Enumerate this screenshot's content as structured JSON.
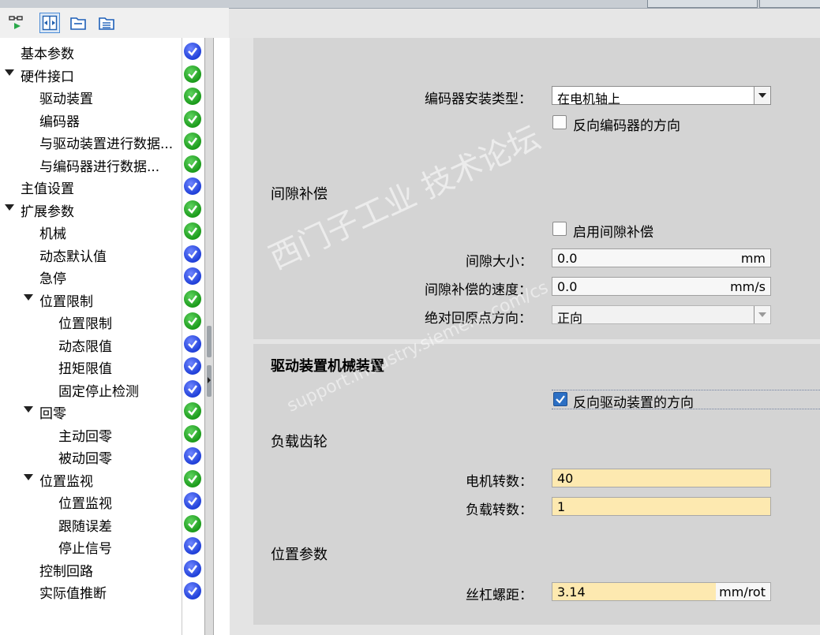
{
  "tree": [
    {
      "label": "基本参数",
      "depth": 0,
      "expander": false,
      "status": "blue"
    },
    {
      "label": "硬件接口",
      "depth": 0,
      "expander": true,
      "status": "green"
    },
    {
      "label": "驱动装置",
      "depth": 1,
      "expander": false,
      "status": "green"
    },
    {
      "label": "编码器",
      "depth": 1,
      "expander": false,
      "status": "green"
    },
    {
      "label": "与驱动装置进行数据...",
      "depth": 1,
      "expander": false,
      "status": "green"
    },
    {
      "label": "与编码器进行数据...",
      "depth": 1,
      "expander": false,
      "status": "green"
    },
    {
      "label": "主值设置",
      "depth": 0,
      "expander": false,
      "status": "blue"
    },
    {
      "label": "扩展参数",
      "depth": 0,
      "expander": true,
      "status": "green"
    },
    {
      "label": "机械",
      "depth": 1,
      "expander": false,
      "status": "green",
      "selected": true
    },
    {
      "label": "动态默认值",
      "depth": 1,
      "expander": false,
      "status": "blue"
    },
    {
      "label": "急停",
      "depth": 1,
      "expander": false,
      "status": "blue"
    },
    {
      "label": "位置限制",
      "depth": 1,
      "expander": true,
      "status": "green"
    },
    {
      "label": "位置限制",
      "depth": 2,
      "expander": false,
      "status": "green"
    },
    {
      "label": "动态限值",
      "depth": 2,
      "expander": false,
      "status": "blue"
    },
    {
      "label": "扭矩限值",
      "depth": 2,
      "expander": false,
      "status": "blue"
    },
    {
      "label": "固定停止检测",
      "depth": 2,
      "expander": false,
      "status": "blue"
    },
    {
      "label": "回零",
      "depth": 1,
      "expander": true,
      "status": "green"
    },
    {
      "label": "主动回零",
      "depth": 2,
      "expander": false,
      "status": "green"
    },
    {
      "label": "被动回零",
      "depth": 2,
      "expander": false,
      "status": "blue"
    },
    {
      "label": "位置监视",
      "depth": 1,
      "expander": true,
      "status": "green"
    },
    {
      "label": "位置监视",
      "depth": 2,
      "expander": false,
      "status": "blue"
    },
    {
      "label": "跟随误差",
      "depth": 2,
      "expander": false,
      "status": "green"
    },
    {
      "label": "停止信号",
      "depth": 2,
      "expander": false,
      "status": "blue"
    },
    {
      "label": "控制回路",
      "depth": 1,
      "expander": false,
      "status": "blue"
    },
    {
      "label": "实际值推断",
      "depth": 1,
      "expander": false,
      "status": "blue"
    }
  ],
  "encoder": {
    "mount_label": "编码器安装类型：",
    "mount_value": "在电机轴上",
    "invert_label": "反向编码器的方向",
    "invert_checked": false
  },
  "backlash": {
    "title": "间隙补偿",
    "enable_label": "启用间隙补偿",
    "enable_checked": false,
    "size_label": "间隙大小：",
    "size_value": "0.0",
    "size_unit": "mm",
    "speed_label": "间隙补偿的速度：",
    "speed_value": "0.0",
    "speed_unit": "mm/s",
    "home_dir_label": "绝对回原点方向：",
    "home_dir_value": "正向"
  },
  "drive_mech": {
    "title": "驱动装置机械装置",
    "invert_label": "反向驱动装置的方向",
    "invert_checked": true
  },
  "load_gear": {
    "title": "负载齿轮",
    "motor_rev_label": "电机转数：",
    "motor_rev_value": "40",
    "load_rev_label": "负载转数：",
    "load_rev_value": "1"
  },
  "position": {
    "title": "位置参数",
    "pitch_label": "丝杠螺距：",
    "pitch_value": "3.14",
    "pitch_unit": "mm/rot"
  },
  "watermark": {
    "line1": "西门子工业 技术论坛",
    "line2": "support.industry.siemens.com/cs"
  },
  "colors": {
    "status_green": "#1a9a1a",
    "status_blue": "#1f3fd8",
    "field_yellow": "#fde9b0",
    "checkbox_blue": "#2b6fc4"
  },
  "icons": [
    "simulate-icon",
    "expand-view-icon",
    "folder-icon",
    "folder-list-icon"
  ]
}
